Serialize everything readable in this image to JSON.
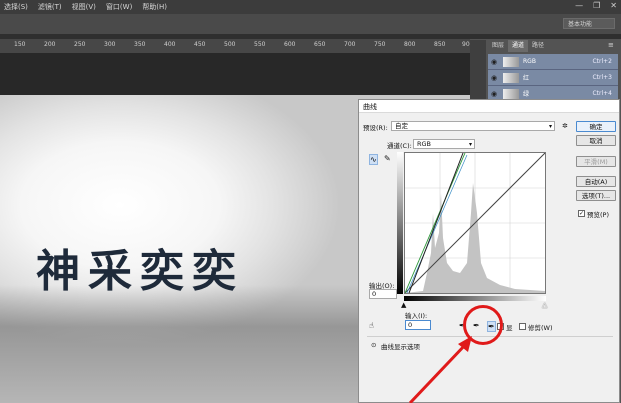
{
  "menu": [
    "选择(S)",
    "滤镜(T)",
    "视图(V)",
    "窗口(W)",
    "帮助(H)"
  ],
  "window_controls": {
    "minimize": "—",
    "restore": "❐",
    "close": "✕"
  },
  "workspace_label": "基本功能",
  "ruler_labels": [
    "150",
    "200",
    "250",
    "300",
    "350",
    "400",
    "450",
    "500",
    "550",
    "600",
    "650",
    "700",
    "750",
    "800",
    "850",
    "900"
  ],
  "canvas_text": "神采奕奕",
  "panel": {
    "tabs": [
      "图层",
      "通道",
      "路径"
    ],
    "active_tab": 1,
    "channels": [
      {
        "name": "RGB",
        "shortcut": "Ctrl+2"
      },
      {
        "name": "红",
        "shortcut": "Ctrl+3"
      },
      {
        "name": "绿",
        "shortcut": "Ctrl+4"
      }
    ]
  },
  "dialog": {
    "title": "曲线",
    "preset_label": "预设(R):",
    "preset_value": "自定",
    "channel_label": "通道(C):",
    "channel_value": "RGB",
    "buttons": {
      "ok": "确定",
      "cancel": "取消",
      "smooth": "平滑(M)",
      "auto": "自动(A)",
      "options": "选项(T)..."
    },
    "preview_label": "预览(P)",
    "output_label": "输出(O):",
    "output_value": "0",
    "input_label": "输入(I):",
    "input_value": "0",
    "show_label": "显",
    "clipping_label": "修剪(W)",
    "display_options": "曲线显示选项"
  },
  "colors": {
    "annotation_red": "#e01a1a",
    "channel_row": "#7a8aa4",
    "ok_border": "#4a8ad0"
  },
  "icons": [
    "pencil-icon",
    "curve-point-icon",
    "eyedropper-black-icon",
    "eyedropper-gray-icon",
    "eyedropper-white-icon",
    "hand-target-icon",
    "gear-icon",
    "eye-icon"
  ]
}
